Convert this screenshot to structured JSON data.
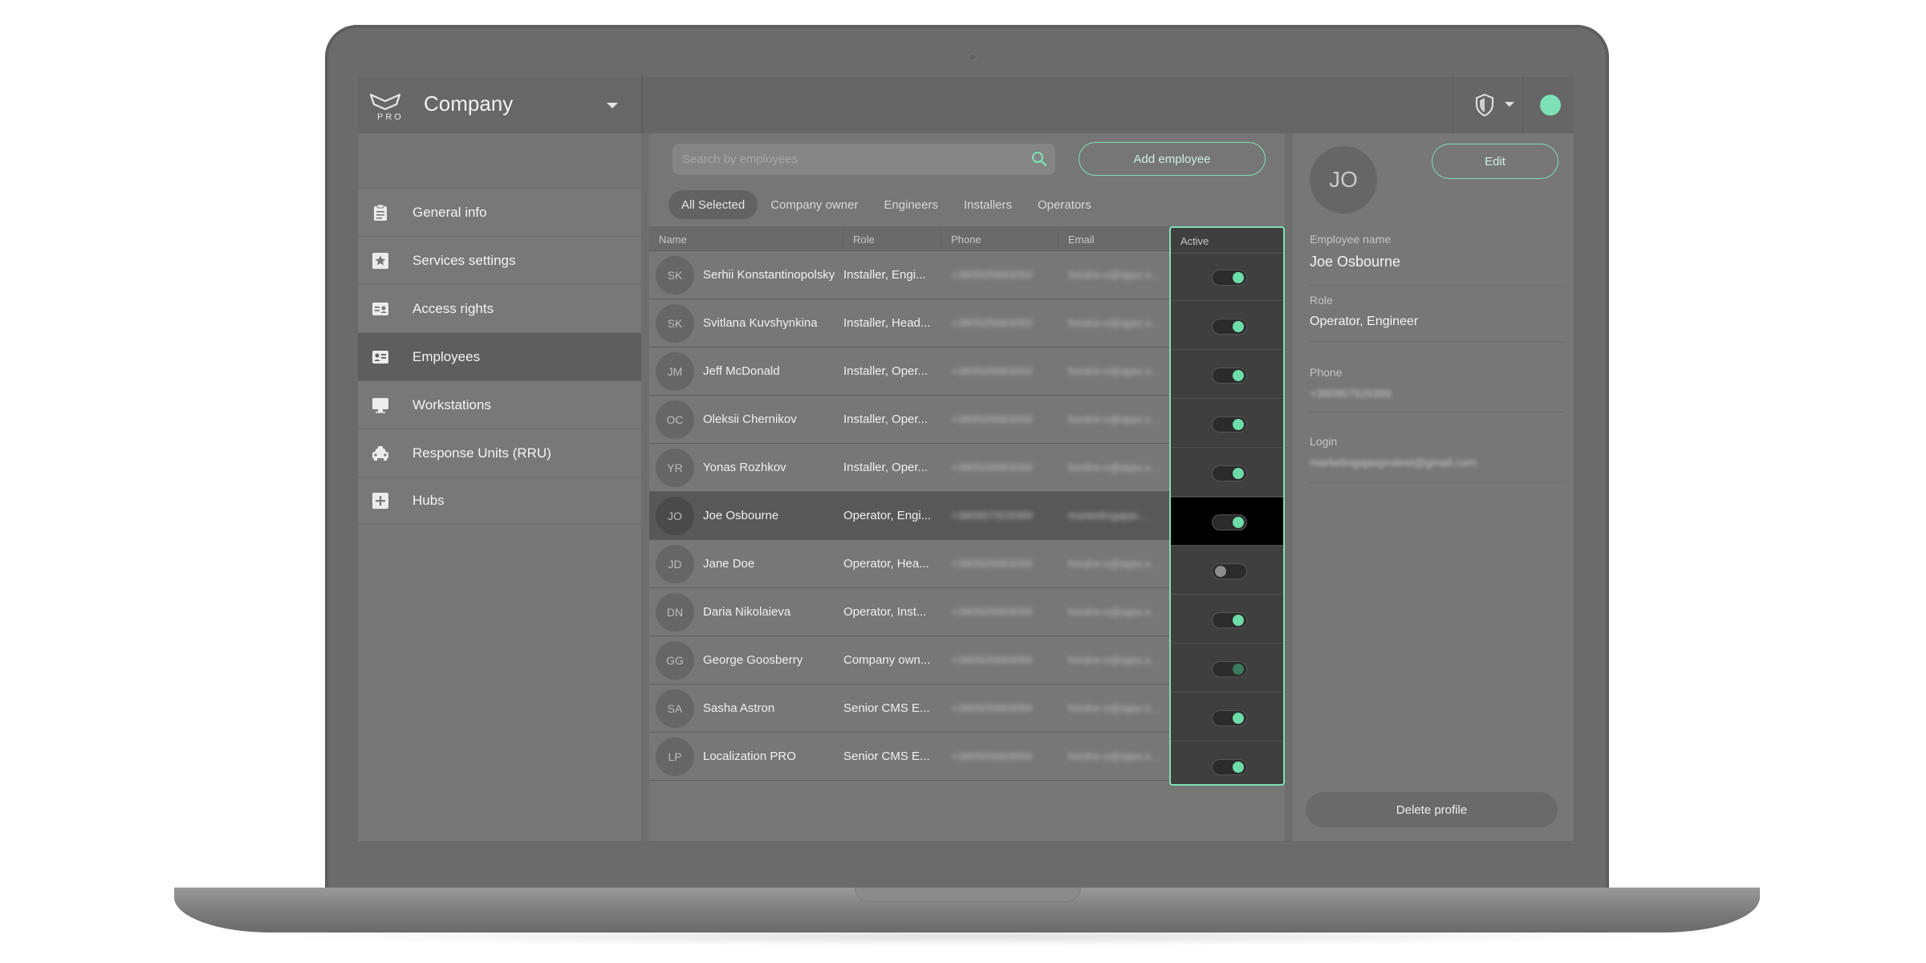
{
  "brand": {
    "logo_text": "PRO",
    "company": "Company"
  },
  "sidebar": {
    "items": [
      {
        "label": "General info",
        "icon": "clipboard-icon"
      },
      {
        "label": "Services settings",
        "icon": "star-icon"
      },
      {
        "label": "Access rights",
        "icon": "id-card-icon"
      },
      {
        "label": "Employees",
        "icon": "employee-card-icon",
        "active": true
      },
      {
        "label": "Workstations",
        "icon": "monitor-icon"
      },
      {
        "label": "Response Units (RRU)",
        "icon": "car-icon"
      },
      {
        "label": "Hubs",
        "icon": "plus-box-icon"
      }
    ]
  },
  "search": {
    "placeholder": "Search by employees"
  },
  "add_button": "Add employee",
  "filters": [
    "All Selected",
    "Company owner",
    "Engineers",
    "Installers",
    "Operators"
  ],
  "table": {
    "columns": {
      "name": "Name",
      "role": "Role",
      "phone": "Phone",
      "email": "Email",
      "active": "Active"
    },
    "rows": [
      {
        "initials": "SK",
        "name": "Serhii Konstantinopolsky",
        "role": "Installer, Engi...",
        "phone": "+380505683050",
        "email": "fondre-o@ajax.s...",
        "active": true
      },
      {
        "initials": "SK",
        "name": "Svitlana Kuvshynkina",
        "role": "Installer, Head...",
        "phone": "+380505683050",
        "email": "fondre-o@ajax.s...",
        "active": true
      },
      {
        "initials": "JM",
        "name": "Jeff McDonald",
        "role": "Installer, Oper...",
        "phone": "+380505683050",
        "email": "fondre-o@ajax.s...",
        "active": true
      },
      {
        "initials": "OC",
        "name": "Oleksii Chernikov",
        "role": "Installer, Oper...",
        "phone": "+380505683050",
        "email": "fondre-o@ajax.s...",
        "active": true
      },
      {
        "initials": "YR",
        "name": "Yonas Rozhkov",
        "role": "Installer, Oper...",
        "phone": "+380505683050",
        "email": "fondre-o@ajax.s...",
        "active": true
      },
      {
        "initials": "JO",
        "name": "Joe Osbourne",
        "role": "Operator, Engi...",
        "phone": "+380957929399",
        "email": "marketingajax...",
        "active": true,
        "selected": true
      },
      {
        "initials": "JD",
        "name": "Jane Doe",
        "role": "Operator, Hea...",
        "phone": "+380505683050",
        "email": "fondre-o@ajax.s...",
        "active": false
      },
      {
        "initials": "DN",
        "name": "Daria Nikolaieva",
        "role": "Operator, Inst...",
        "phone": "+380505683050",
        "email": "fondre-o@ajax.s...",
        "active": true
      },
      {
        "initials": "GG",
        "name": "George Goosberry",
        "role": "Company own...",
        "phone": "+380505683050",
        "email": "fondre-o@ajax.s...",
        "active": true,
        "dim": true
      },
      {
        "initials": "SA",
        "name": "Sasha Astron",
        "role": "Senior CMS E...",
        "phone": "+380505683050",
        "email": "fondre-o@ajax.s...",
        "active": true
      },
      {
        "initials": "LP",
        "name": "Localization PRO",
        "role": "Senior CMS E...",
        "phone": "+380505683050",
        "email": "fondre-o@ajax.s...",
        "active": true
      }
    ]
  },
  "detail": {
    "initials": "JO",
    "edit_button": "Edit",
    "employee_name_label": "Employee name",
    "employee_name": "Joe Osbourne",
    "role_label": "Role",
    "role": "Operator, Engineer",
    "phone_label": "Phone",
    "phone": "+380957929399",
    "login_label": "Login",
    "login": "marketingajaxprotest@gmail.com",
    "delete_button": "Delete profile"
  },
  "colors": {
    "accent": "#7de0b6",
    "toggle_on": "#6ddca9",
    "selected_row": "#585858"
  }
}
